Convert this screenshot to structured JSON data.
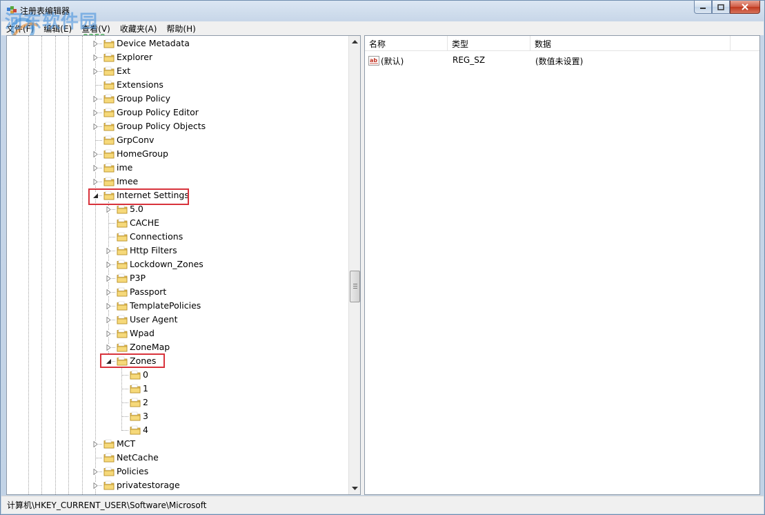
{
  "window": {
    "title": "注册表编辑器"
  },
  "watermark": {
    "text": "河东软件园",
    "url": "www.pc0359.cn"
  },
  "menu": [
    "文件(F)",
    "编辑(E)",
    "查看(V)",
    "收藏夹(A)",
    "帮助(H)"
  ],
  "tree": {
    "level1_items": [
      {
        "label": "Device Metadata",
        "expandable": true
      },
      {
        "label": "Explorer",
        "expandable": true
      },
      {
        "label": "Ext",
        "expandable": true
      },
      {
        "label": "Extensions",
        "expandable": false
      },
      {
        "label": "Group Policy",
        "expandable": true
      },
      {
        "label": "Group Policy Editor",
        "expandable": true
      },
      {
        "label": "Group Policy Objects",
        "expandable": true
      },
      {
        "label": "GrpConv",
        "expandable": false
      },
      {
        "label": "HomeGroup",
        "expandable": true
      },
      {
        "label": "ime",
        "expandable": true
      },
      {
        "label": "Imee",
        "expandable": true
      },
      {
        "label": "Internet Settings",
        "expandable": true,
        "expanded": true,
        "highlighted": true
      }
    ],
    "internet_settings_children": [
      {
        "label": "5.0",
        "expandable": true
      },
      {
        "label": "CACHE",
        "expandable": false
      },
      {
        "label": "Connections",
        "expandable": false
      },
      {
        "label": "Http Filters",
        "expandable": true
      },
      {
        "label": "Lockdown_Zones",
        "expandable": true
      },
      {
        "label": "P3P",
        "expandable": true
      },
      {
        "label": "Passport",
        "expandable": true
      },
      {
        "label": "TemplatePolicies",
        "expandable": true
      },
      {
        "label": "User Agent",
        "expandable": true
      },
      {
        "label": "Wpad",
        "expandable": true
      },
      {
        "label": "ZoneMap",
        "expandable": true
      },
      {
        "label": "Zones",
        "expandable": true,
        "expanded": true,
        "highlighted": true
      }
    ],
    "zones_children": [
      "0",
      "1",
      "2",
      "3",
      "4"
    ],
    "level1_after": [
      {
        "label": "MCT",
        "expandable": true
      },
      {
        "label": "NetCache",
        "expandable": false
      },
      {
        "label": "Policies",
        "expandable": true
      },
      {
        "label": "privatestorage",
        "expandable": true
      }
    ]
  },
  "list": {
    "columns": [
      "名称",
      "类型",
      "数据"
    ],
    "rows": [
      {
        "name": "(默认)",
        "type": "REG_SZ",
        "data": "(数值未设置)",
        "icon": "string-value-icon"
      }
    ]
  },
  "status": {
    "path": "计算机\\HKEY_CURRENT_USER\\Software\\Microsoft"
  },
  "colors": {
    "highlight_box": "#d8323b",
    "folder": "#e8c15a"
  }
}
